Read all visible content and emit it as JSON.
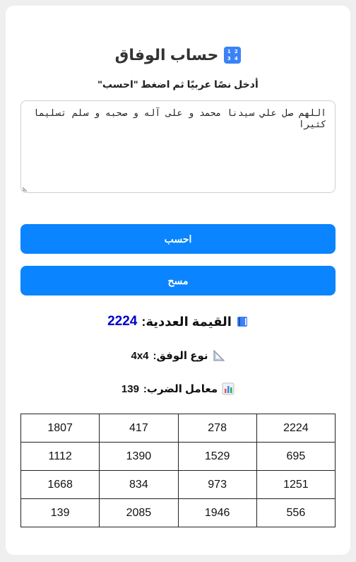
{
  "header": {
    "title": "حساب الوفاق",
    "icon_glyphs": [
      "1",
      "2",
      "3",
      "4"
    ]
  },
  "form": {
    "instruction": "أدخل نصًا عربيًا ثم اضغط \"احسب\"",
    "input_value": "اللهم صل علي سيدنا محمد و على آله و صحبه و سلم تسليما كثيرا",
    "calculate_label": "احسب",
    "clear_label": "مسح"
  },
  "results": {
    "value_label": "القيمة العددية:",
    "value": "2224",
    "type_label": "نوع الوفق:",
    "type": "4x4",
    "multiplier_label": "معامل الضرب:",
    "multiplier": "139"
  },
  "grid": {
    "rows": [
      [
        "2224",
        "278",
        "417",
        "1807"
      ],
      [
        "695",
        "1529",
        "1390",
        "1112"
      ],
      [
        "1251",
        "973",
        "834",
        "1668"
      ],
      [
        "556",
        "1946",
        "2085",
        "139"
      ]
    ]
  },
  "colors": {
    "accent": "#0a84ff",
    "value_color": "#0000cc",
    "title_color": "#333333"
  }
}
